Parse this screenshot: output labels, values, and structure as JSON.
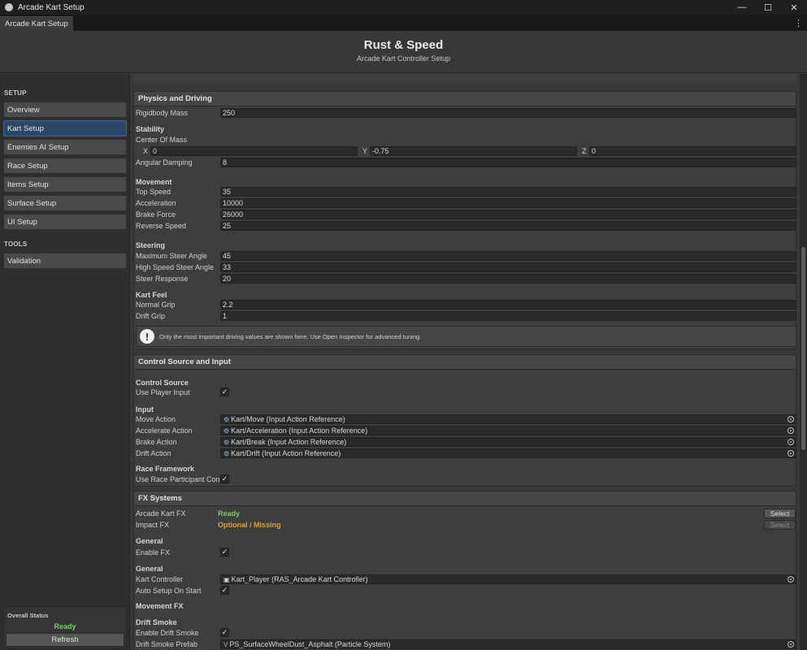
{
  "window": {
    "title": "Arcade Kart Setup",
    "tab": "Arcade Kart Setup",
    "minimize": "—",
    "maximize": "☐",
    "close": "✕",
    "menu": "⋮"
  },
  "header": {
    "title": "Rust & Speed",
    "subtitle": "Arcade Kart Controller Setup"
  },
  "sidebar": {
    "setup_label": "SETUP",
    "setup_items": [
      "Overview",
      "Kart Setup",
      "Enemies AI Setup",
      "Race Setup",
      "Items Setup",
      "Surface Setup",
      "UI Setup"
    ],
    "active_item": "Kart Setup",
    "tools_label": "TOOLS",
    "tools_items": [
      "Validation"
    ],
    "status_label": "Overall Status",
    "status_value": "Ready",
    "refresh_label": "Refresh"
  },
  "physics": {
    "header": "Physics and Driving",
    "rigidbody_mass_label": "Rigidbody Mass",
    "rigidbody_mass": "250",
    "stability_group": "Stability",
    "center_of_mass_label": "Center Of Mass",
    "x_label": "X",
    "x": "0",
    "y_label": "Y",
    "y": "-0.75",
    "z_label": "Z",
    "z": "0",
    "angular_damping_label": "Angular Damping",
    "angular_damping": "8",
    "movement_group": "Movement",
    "top_speed_label": "Top Speed",
    "top_speed": "35",
    "acceleration_label": "Acceleration",
    "acceleration": "10000",
    "brake_force_label": "Brake Force",
    "brake_force": "26000",
    "reverse_speed_label": "Reverse Speed",
    "reverse_speed": "25",
    "steering_group": "Steering",
    "max_steer_label": "Maximum Steer Angle",
    "max_steer": "45",
    "high_speed_steer_label": "High Speed Steer Angle",
    "high_speed_steer": "33",
    "steer_response_label": "Steer Response",
    "steer_response": "20",
    "kart_feel_group": "Kart Feel",
    "normal_grip_label": "Normal Grip",
    "normal_grip": "2.2",
    "drift_grip_label": "Drift Grip",
    "drift_grip": "1",
    "info_icon": "!",
    "info": "Only the most important driving values are shown here. Use Open Inspector for advanced tuning."
  },
  "control": {
    "header": "Control Source and Input",
    "source_group": "Control Source",
    "use_player_input_label": "Use Player Input",
    "use_player_input": "✓",
    "input_group": "Input",
    "move_label": "Move Action",
    "move": "Kart/Move (Input Action Reference)",
    "accelerate_label": "Accelerate Action",
    "accelerate": "Kart/Acceleration (Input Action Reference)",
    "brake_label": "Brake Action",
    "brake": "Kart/Break (Input Action Reference)",
    "drift_label": "Drift Action",
    "drift": "Kart/Drift (Input Action Reference)",
    "race_framework_group": "Race Framework",
    "race_participant_label": "Use Race Participant Conti",
    "race_participant": "✓"
  },
  "fx": {
    "header": "FX Systems",
    "arcade_fx_label": "Arcade Kart FX",
    "arcade_fx_status": "Ready",
    "impact_fx_label": "Impact FX",
    "impact_fx_status": "Optional / Missing",
    "select_label": "Select",
    "general_group": "General",
    "enable_fx_label": "Enable FX",
    "enable_fx": "✓",
    "general_group_2": "General",
    "kart_controller_label": "Kart Controller",
    "kart_controller": "Kart_Player (RAS_Arcade Kart Controller)",
    "auto_setup_label": "Auto Setup On Start",
    "auto_setup": "✓",
    "movement_fx_group": "Movement FX",
    "drift_smoke_group": "Drift Smoke",
    "enable_drift_smoke_label": "Enable Drift Smoke",
    "enable_drift_smoke": "✓",
    "drift_smoke_prefab_label": "Drift Smoke Prefab",
    "drift_smoke_prefab": "PS_SurfaceWheelDust_Asphalt (Particle System)"
  },
  "colors": {
    "accent": "#2b4768",
    "ready": "#6fce5c",
    "warning": "#e0a030"
  },
  "icons": {
    "input_action": "input-action-icon",
    "object_picker": "object-picker-icon",
    "script": "script-icon",
    "particle": "particle-system-icon"
  }
}
